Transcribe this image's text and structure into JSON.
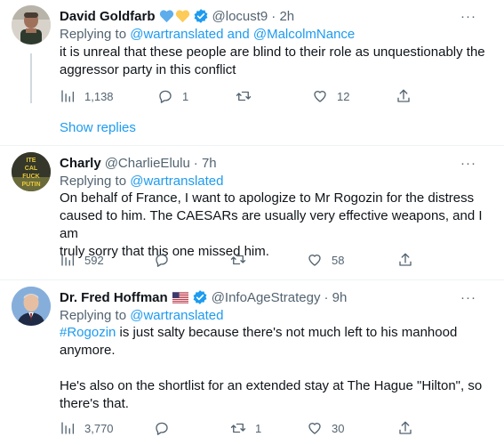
{
  "tweets": [
    {
      "name": "David Goldfarb",
      "emojis": [
        "blue-heart",
        "yellow-heart"
      ],
      "verified": true,
      "handle": "@locust9",
      "time": "· 2h",
      "reply_prefix": "Replying to ",
      "reply_to": "@wartranslated and @MalcolmNance",
      "text_lines": [
        "it is unreal that these people are blind to their role as unquestionably the",
        "aggressor party in this conflict"
      ],
      "views": "1,138",
      "replies": "1",
      "retweets": "",
      "likes": "12",
      "show_replies": "Show replies"
    },
    {
      "name": "Charly",
      "avatar_text": [
        "ITE",
        "CAL",
        "FUCK",
        "PUTIN"
      ],
      "handle": "@CharlieElulu",
      "time": "· 7h",
      "reply_prefix": "Replying to ",
      "reply_to": "@wartranslated",
      "text_lines": [
        "On behalf of France, I want to apologize to Mr Rogozin for the distress",
        "caused to him. The CAESARs are usually very effective weapons, and I am",
        "truly sorry that this one missed him."
      ],
      "views": "592",
      "replies": "",
      "retweets": "",
      "likes": "58"
    },
    {
      "name": "Dr. Fred Hoffman",
      "emojis": [
        "us-flag"
      ],
      "verified": true,
      "handle": "@InfoAgeStrategy",
      "time": "· 9h",
      "reply_prefix": "Replying to ",
      "reply_to": "@wartranslated",
      "hashtag": "#Rogozin",
      "text_line1_rest": " is just salty because there's not much left to his manhood",
      "text_line2": "anymore.",
      "text_para2_lines": [
        "He's also on the shortlist for an extended stay at The Hague \"Hilton\", so",
        "there's that."
      ],
      "views": "3,770",
      "replies": "",
      "retweets": "1",
      "likes": "30"
    }
  ],
  "colors": {
    "link": "#1d9bf0",
    "secondary_text": "#536471",
    "primary_text": "#0f1419",
    "divider": "#eff3f4",
    "verified": "#1d9bf0"
  }
}
